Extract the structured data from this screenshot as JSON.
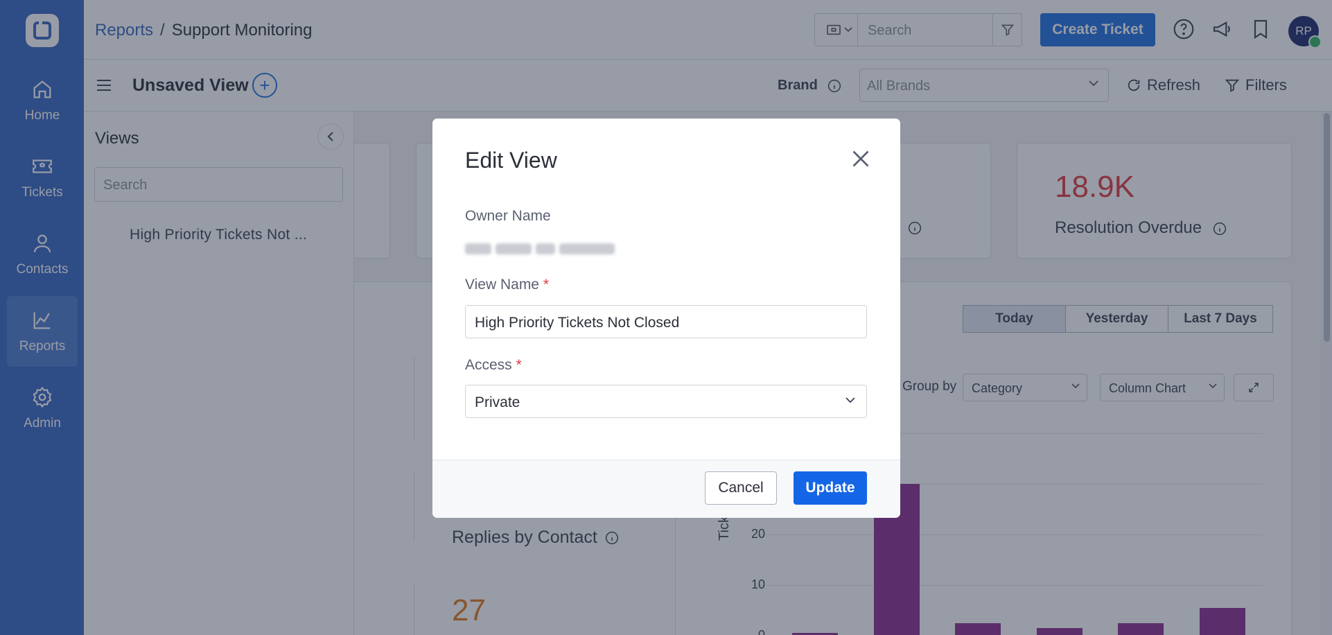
{
  "sidebar": {
    "logo": "app-logo",
    "items": [
      {
        "label": "Home",
        "icon": "home-icon"
      },
      {
        "label": "Tickets",
        "icon": "ticket-icon"
      },
      {
        "label": "Contacts",
        "icon": "contact-icon"
      },
      {
        "label": "Reports",
        "icon": "chart-icon",
        "active": true
      },
      {
        "label": "Admin",
        "icon": "gear-icon"
      }
    ]
  },
  "header": {
    "breadcrumb_root": "Reports",
    "breadcrumb_sep": "/",
    "breadcrumb_current": "Support Monitoring",
    "search_placeholder": "Search",
    "create_ticket": "Create Ticket",
    "avatar_initials": "RP"
  },
  "subbar": {
    "view_title": "Unsaved View",
    "brand_label": "Brand",
    "brand_placeholder": "All Brands",
    "refresh": "Refresh",
    "filters": "Filters"
  },
  "views_panel": {
    "title": "Views",
    "search_placeholder": "Search",
    "items": [
      "High Priority Tickets Not ..."
    ]
  },
  "dashboard": {
    "kpi_resolution_value": "18.9K",
    "kpi_resolution_label": "Resolution Overdue",
    "date_tabs": [
      "Today",
      "Yesterday",
      "Last 7 Days"
    ],
    "group_by_label": "Group by",
    "group_by_value": "Category",
    "chart_type_value": "Column Chart",
    "replies_label": "Replies by Contact",
    "replies_value": "27",
    "accent_colors": {
      "bar": "#8a2c8f",
      "kpi_red": "#e0383e",
      "kpi_orange": "#e07a1a"
    }
  },
  "chart_data": {
    "type": "bar",
    "ylabel": "Ticket Co",
    "yticks": [
      "0",
      "10",
      "20"
    ],
    "values": [
      0.5,
      30,
      2.5,
      1.5,
      2.5,
      5.5
    ],
    "ylim": [
      0,
      30
    ]
  },
  "modal": {
    "title": "Edit View",
    "owner_label": "Owner Name",
    "view_name_label": "View Name",
    "view_name_value": "High Priority Tickets Not Closed",
    "access_label": "Access",
    "access_value": "Private",
    "required_mark": "*",
    "cancel": "Cancel",
    "update": "Update"
  }
}
